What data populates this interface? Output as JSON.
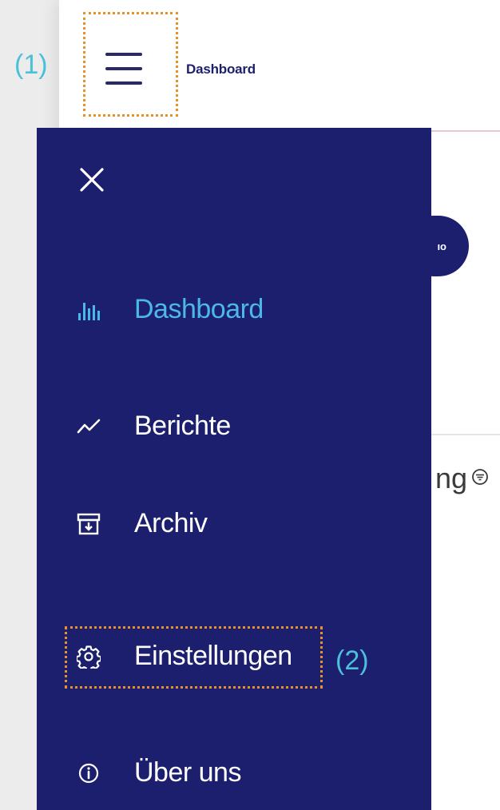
{
  "annotations": {
    "step1": "(1)",
    "step2": "(2)"
  },
  "topbar": {
    "title": "Dashboard"
  },
  "background": {
    "pill_text": "ıo",
    "partial_text": "ng"
  },
  "drawer": {
    "items": [
      {
        "label": "Dashboard",
        "icon": "bar-chart-icon",
        "active": true
      },
      {
        "label": "Berichte",
        "icon": "trend-line-icon",
        "active": false
      },
      {
        "label": "Archiv",
        "icon": "archive-icon",
        "active": false
      },
      {
        "label": "Einstellungen",
        "icon": "gear-icon",
        "active": false
      },
      {
        "label": "Über uns",
        "icon": "info-icon",
        "active": false
      }
    ]
  },
  "colors": {
    "drawer_bg": "#1c1f6e",
    "active": "#4bb8e8",
    "annotation": "#4bc0d9",
    "highlight_border": "#e8912b"
  }
}
